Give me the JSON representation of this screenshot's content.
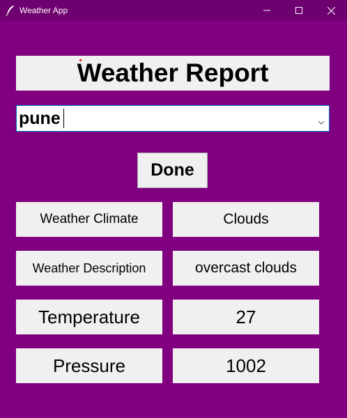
{
  "window": {
    "title": "Weather App",
    "icon": "feather-icon",
    "controls": [
      "minimize-icon",
      "maximize-icon",
      "close-icon"
    ]
  },
  "header": {
    "title": "Weather Report"
  },
  "city_input": {
    "value": "pune"
  },
  "actions": {
    "done_label": "Done"
  },
  "rows": [
    {
      "label": "Weather Climate",
      "value": "Clouds"
    },
    {
      "label": "Weather Description",
      "value": "overcast clouds"
    },
    {
      "label": "Temperature",
      "value": "27"
    },
    {
      "label": "Pressure",
      "value": "1002"
    }
  ],
  "colors": {
    "background": "#800080",
    "titlebar": "#6f006f",
    "panel": "#f0f0f0",
    "focus_border": "#0078d7"
  }
}
